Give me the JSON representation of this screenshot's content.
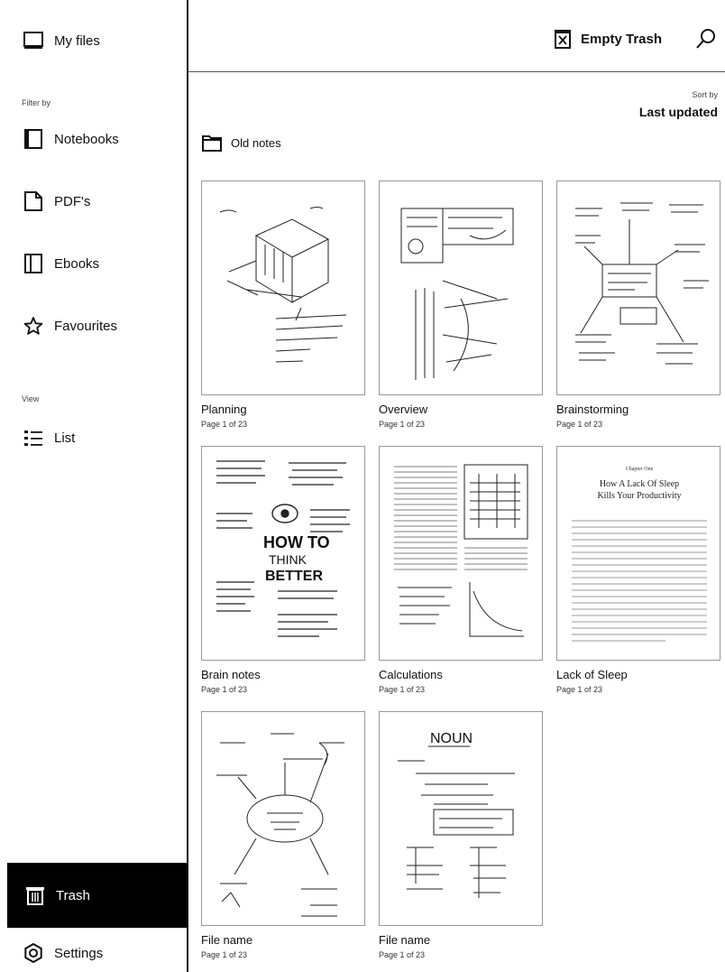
{
  "sidebar": {
    "my_files": "My files",
    "filter_by": "Filter by",
    "filters": [
      {
        "label": "Notebooks",
        "icon": "notebook-icon"
      },
      {
        "label": "PDF's",
        "icon": "pdf-icon"
      },
      {
        "label": "Ebooks",
        "icon": "ebook-icon"
      },
      {
        "label": "Favourites",
        "icon": "star-icon"
      }
    ],
    "view_label": "View",
    "list": "List",
    "trash": "Trash",
    "settings": "Settings"
  },
  "header": {
    "empty_trash": "Empty Trash",
    "sort_by": "Sort by",
    "sort_value": "Last updated"
  },
  "folder": {
    "name": "Old notes"
  },
  "documents": [
    {
      "title": "Planning",
      "subtitle": "Page 1 of 23"
    },
    {
      "title": "Overview",
      "subtitle": "Page 1 of 23"
    },
    {
      "title": "Brainstorming",
      "subtitle": "Page 1 of 23"
    },
    {
      "title": "Brain notes",
      "subtitle": "Page 1 of 23"
    },
    {
      "title": "Calculations",
      "subtitle": "Page 1 of 23"
    },
    {
      "title": "Lack of Sleep",
      "subtitle": "Page 1 of 23"
    },
    {
      "title": "File name",
      "subtitle": "Page 1 of 23"
    },
    {
      "title": "File name",
      "subtitle": "Page 1 of 23"
    }
  ],
  "thumb_text": {
    "brain_notes": [
      "HOW TO",
      "THINK",
      "BETTER"
    ],
    "lack_of_sleep": [
      "Chapter One",
      "How A Lack Of Sleep",
      "Kills Your Productivity"
    ],
    "file_name_2": "NOUN"
  },
  "colors": {
    "accent": "#000000",
    "background": "#ffffff"
  }
}
